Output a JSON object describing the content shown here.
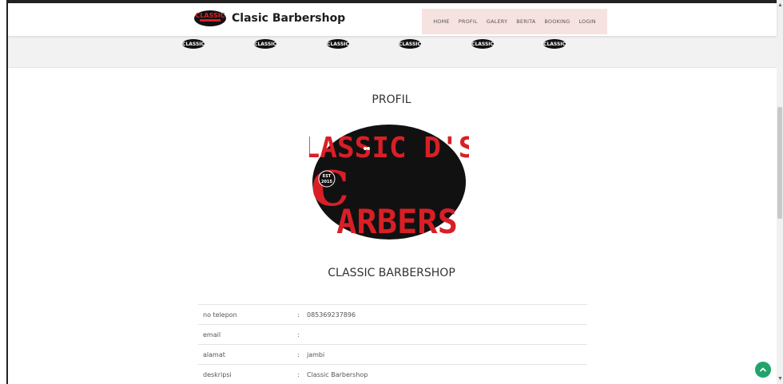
{
  "brand": {
    "name": "Clasic Barbershop",
    "logo_text": "CLASSIC"
  },
  "nav": {
    "items": [
      "HOME",
      "PROFIL",
      "GALERY",
      "BERITA",
      "BOOKING",
      "LOGIN"
    ]
  },
  "strip": {
    "logo_count": 6,
    "logo_text": "CLASSIC"
  },
  "profile": {
    "title": "PROFIL",
    "shop_name": "CLASSIC BARBERSHOP",
    "logo": {
      "line1": "LASSIC D'S",
      "big_c": "C",
      "line2": "ARBERS",
      "est_line1": "EST",
      "est_line2": "2015"
    },
    "rows": [
      {
        "label": "no telepon",
        "sep": ":",
        "value": "085369237896"
      },
      {
        "label": "email",
        "sep": ":",
        "value": ""
      },
      {
        "label": "alamat",
        "sep": ":",
        "value": "jambi"
      },
      {
        "label": "deskripsi",
        "sep": ":",
        "value": "Classic Barbershop"
      }
    ]
  },
  "colors": {
    "accent_red": "#d91f26",
    "logo_black": "#111111",
    "nav_bg": "#f7e2e2",
    "back_top": "#21a46b"
  },
  "icons": {
    "back_to_top": "chevron-up-icon",
    "scroll_up": "arrow-up-icon",
    "scroll_down": "arrow-down-icon"
  }
}
